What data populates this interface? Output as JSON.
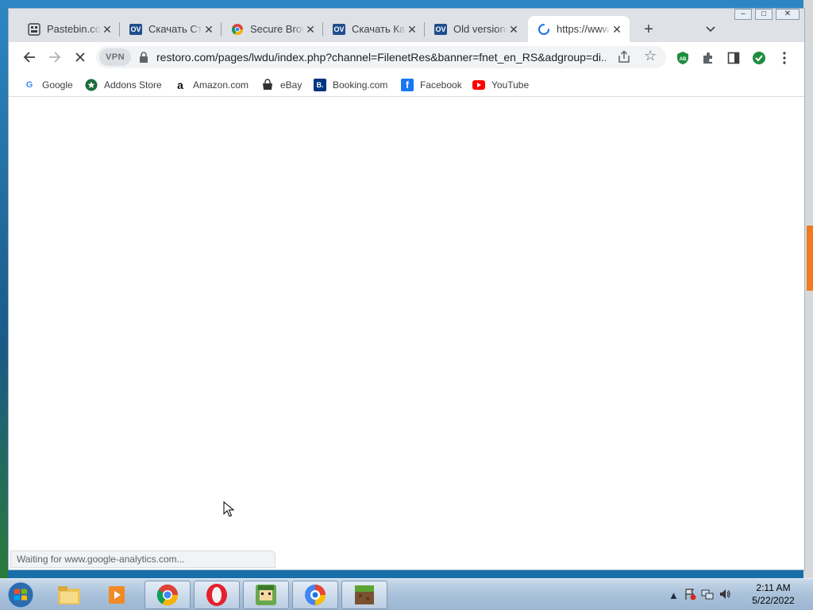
{
  "browser": {
    "tabs": [
      {
        "title": "Pastebin.com",
        "favicon": "pastebin-icon",
        "active": false
      },
      {
        "title": "Скачать Ста",
        "favicon": "ov-icon",
        "active": false
      },
      {
        "title": "Secure Brow",
        "favicon": "chrome-icon",
        "active": false
      },
      {
        "title": "Скачать Кас",
        "favicon": "ov-icon",
        "active": false
      },
      {
        "title": "Old versions",
        "favicon": "ov-icon",
        "active": false
      },
      {
        "title": "https://www.",
        "favicon": "loading-spinner-icon",
        "active": true
      }
    ],
    "favicon_text": {
      "ov": "OV"
    },
    "new_tab_label": "+",
    "window_controls": [
      "–",
      "□",
      "✕"
    ],
    "toolbar": {
      "vpn_label": "VPN",
      "url": "restoro.com/pages/lwdu/index.php?channel=FilenetRes&banner=fnet_en_RS&adgroup=di..."
    },
    "bookmarks": [
      {
        "label": "Google",
        "icon": "google-icon"
      },
      {
        "label": "Addons Store",
        "icon": "addons-store-icon"
      },
      {
        "label": "Amazon.com",
        "icon": "amazon-icon"
      },
      {
        "label": "eBay",
        "icon": "ebay-icon"
      },
      {
        "label": "Booking.com",
        "icon": "booking-icon"
      },
      {
        "label": "Facebook",
        "icon": "facebook-icon"
      },
      {
        "label": "YouTube",
        "icon": "youtube-icon"
      }
    ],
    "bookmark_glyphs": {
      "google": "G",
      "amazon": "a",
      "booking": "B.",
      "facebook": "f",
      "ext_ab": "AB"
    },
    "status_text": "Waiting for www.google-analytics.com..."
  },
  "taskbar": {
    "items": [
      "file-explorer-icon",
      "media-player-icon",
      "chrome-icon",
      "opera-icon",
      "game-icon",
      "browser-icon",
      "minecraft-icon"
    ],
    "clock_time": "2:11 AM",
    "clock_date": "5/22/2022"
  },
  "colors": {
    "accent": "#1a73e8",
    "ext_green": "#1e8e3e",
    "youtube_red": "#ff0000",
    "facebook_blue": "#1877f2",
    "booking_blue": "#003580"
  }
}
